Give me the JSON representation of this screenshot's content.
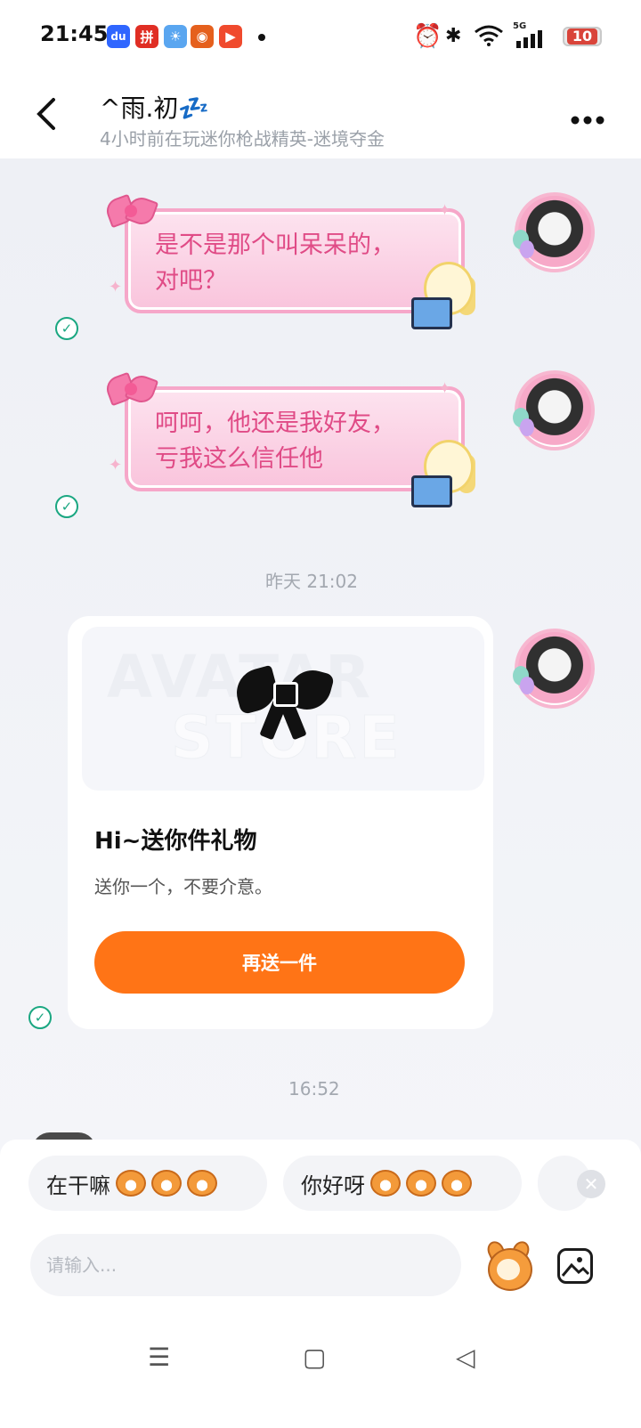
{
  "status_bar": {
    "time": "21:45",
    "apps": [
      {
        "icon": "baidu-icon",
        "glyph": "du",
        "color": "#2f66ff"
      },
      {
        "icon": "pinduoduo-icon",
        "glyph": "拼",
        "color": "#e02e24"
      },
      {
        "icon": "weather-icon",
        "glyph": "☀",
        "color": "#5aa6f0"
      },
      {
        "icon": "pumpkin-icon",
        "glyph": "◉",
        "color": "#e5601d"
      },
      {
        "icon": "video-icon",
        "glyph": "▶",
        "color": "#f04a2d"
      }
    ],
    "network": "5G",
    "battery": "10"
  },
  "header": {
    "title": "^雨.初💤",
    "subtitle": "4小时前在玩迷你枪战精英-迷境夺金"
  },
  "messages": [
    {
      "text_line1": "是不是那个叫呆呆的，",
      "text_line2": "对吧？"
    },
    {
      "text_line1": "呵呵，他还是我好友，",
      "text_line2": "亏我这么信任他"
    }
  ],
  "timestamps": {
    "t1": "昨天 21:02",
    "t2": "16:52"
  },
  "gift_card": {
    "watermark_line1": "AVATAR",
    "watermark_line2": "STORE",
    "title": "Hi~送你件礼物",
    "description": "送你一个，不要介意。",
    "button_label": "再送一件"
  },
  "quick_replies": [
    {
      "label": "在干嘛"
    },
    {
      "label": "你好呀"
    }
  ],
  "input": {
    "placeholder": "请输入..."
  },
  "nav": {
    "menu": "☰",
    "home": "▢",
    "back": "◁"
  }
}
